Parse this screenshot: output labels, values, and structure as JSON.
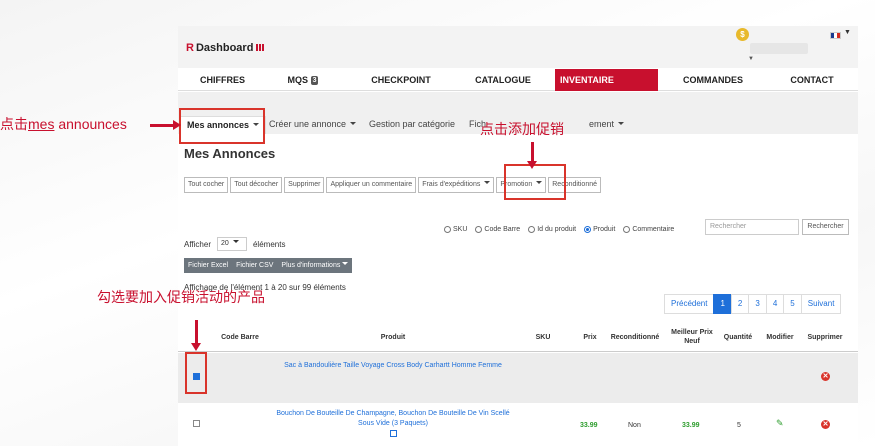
{
  "header": {
    "logo_letter": "R",
    "logo_text": "Dashboard",
    "coin_symbol": "$"
  },
  "main_nav": {
    "items": [
      {
        "label": "CHIFFRES"
      },
      {
        "label": "MQS",
        "badge": "3"
      },
      {
        "label": "CHECKPOINT"
      },
      {
        "label": "CATALOGUE"
      },
      {
        "label": "INVENTAIRE"
      },
      {
        "label": "COMMANDES"
      },
      {
        "label": "CONTACT"
      }
    ],
    "active": "INVENTAIRE"
  },
  "sub_nav": {
    "tabs": [
      {
        "label": "Mes annonces"
      },
      {
        "label": "Créer une annonce"
      },
      {
        "label": "Gestion par catégorie"
      },
      {
        "label": "Fich"
      },
      {
        "label": "ement"
      }
    ]
  },
  "page": {
    "title": "Mes Annonces"
  },
  "actions": {
    "buttons": [
      "Tout cocher",
      "Tout décocher",
      "Supprimer",
      "Appliquer un commentaire",
      "Frais d'expéditions",
      "Promotion",
      "Reconditionné"
    ]
  },
  "search": {
    "options": [
      "SKU",
      "Code Barre",
      "Id du produit",
      "Produit",
      "Commentaire"
    ],
    "selected": "Produit",
    "placeholder": "Rechercher",
    "button": "Rechercher"
  },
  "show": {
    "prefix": "Afficher",
    "value": "20",
    "suffix": "éléments"
  },
  "export": {
    "buttons": [
      "Fichier Excel",
      "Fichier CSV",
      "Plus d'informations"
    ]
  },
  "listing_info": "Affichage de l'élément 1 à 20 sur 99 éléments",
  "pagination": {
    "prev": "Précédent",
    "pages": [
      "1",
      "2",
      "3",
      "4",
      "5"
    ],
    "current": "1",
    "next": "Suivant"
  },
  "table": {
    "headers": {
      "barcode": "Code Barre",
      "product": "Produit",
      "sku": "SKU",
      "price": "Prix",
      "reconditioned": "Reconditionné",
      "best_price": "Meilleur Prix Neuf",
      "quantity": "Quantité",
      "edit": "Modifier",
      "delete": "Supprimer"
    },
    "rows": [
      {
        "checked": true,
        "product": "Sac à Bandoulière Taille Voyage Cross Body Carhartt Homme Femme",
        "price": "",
        "reconditioned": "",
        "best_price": "",
        "quantity": ""
      },
      {
        "checked": false,
        "product": "Bouchon De Bouteille De Champagne, Bouchon De Bouteille De Vin Scellé Sous Vide (3 Paquets)",
        "price": "33.99",
        "reconditioned": "Non",
        "best_price": "33.99",
        "quantity": "5"
      }
    ]
  },
  "annotations": {
    "step1_prefix": "点击",
    "step1_word": "mes",
    "step1_suffix": " announces",
    "step2": "点击添加促销",
    "step3": "勾选要加入促销活动的产品"
  },
  "colors": {
    "brand_red": "#c8102e",
    "link_blue": "#1e6fd9",
    "price_green": "#2e9d2e",
    "annotation_red": "#d9342b"
  }
}
